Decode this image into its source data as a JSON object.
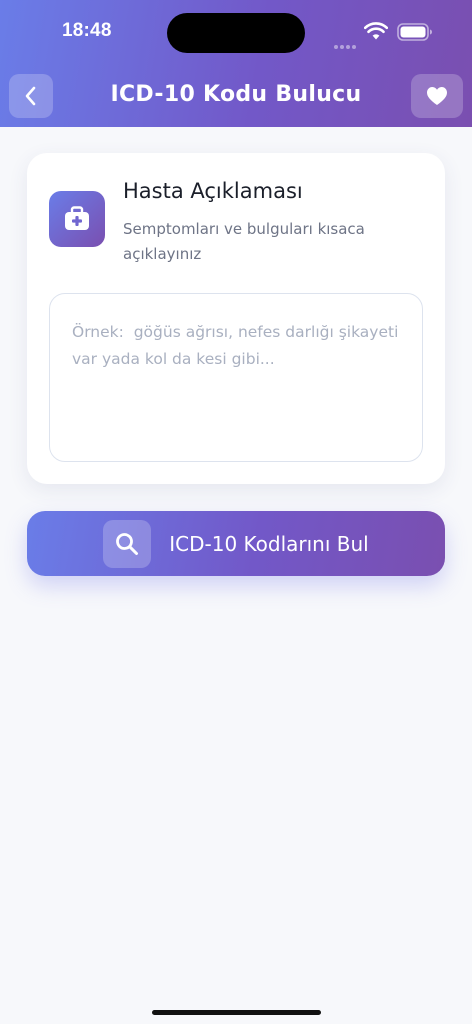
{
  "status_bar": {
    "time": "18:48"
  },
  "header": {
    "title": "ICD-10 Kodu Bulucu",
    "back_icon": "chevron-left-icon",
    "favorite_icon": "heart-icon"
  },
  "card": {
    "icon": "medical-kit-icon",
    "title": "Hasta Açıklaması",
    "subtitle": "Semptomları ve bulguları kısaca açıklayınız",
    "input_value": "",
    "input_placeholder": "Örnek:  göğüs ağrısı, nefes darlığı şikayeti var yada kol da kesi gibi..."
  },
  "action": {
    "label": "ICD-10 Kodlarını Bul",
    "icon": "search-icon"
  },
  "colors": {
    "gradient_start": "#6a7de8",
    "gradient_end": "#7a4fb0",
    "background": "#f7f8fb",
    "card": "#ffffff"
  }
}
